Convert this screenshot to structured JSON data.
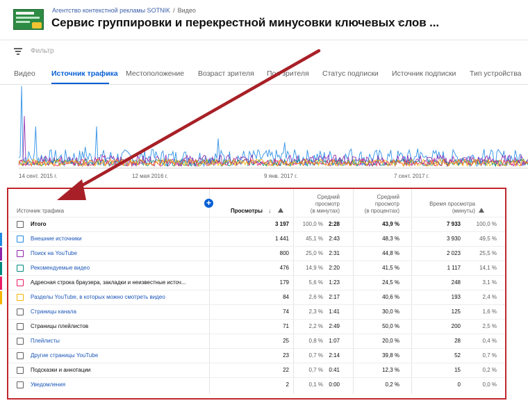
{
  "header": {
    "channel_name": "Агентство контекстной рекламы SOTNIK",
    "breadcrumb_separator": "/",
    "breadcrumb_current": "Видео",
    "title": "Сервис группировки и перекрестной минусовки ключевых слов ..."
  },
  "filter": {
    "placeholder": "Фильтр",
    "icon": "filter-icon"
  },
  "tabs": [
    {
      "label": "Видео",
      "active": false
    },
    {
      "label": "Источник трафика",
      "active": true
    },
    {
      "label": "Местоположение",
      "active": false
    },
    {
      "label": "Возраст зрителя",
      "active": false
    },
    {
      "label": "Пол зрителя",
      "active": false
    },
    {
      "label": "Статус подписки",
      "active": false
    },
    {
      "label": "Источник подписки",
      "active": false
    },
    {
      "label": "Тип устройства",
      "active": false
    }
  ],
  "chart": {
    "x_ticks": [
      "14 сент. 2015 г.",
      "12 мая 2016 г.",
      "9 янв. 2017 г.",
      "7 сент. 2017 г."
    ],
    "series_colors": [
      "#1e88e5",
      "#8e24aa",
      "#00897b",
      "#e91e63",
      "#f4b400"
    ]
  },
  "table": {
    "headers": {
      "source": "Источник трафика",
      "views": "Просмотры",
      "avg_duration": [
        "Средний",
        "просмотр",
        "(в минутах)"
      ],
      "avg_percent": [
        "Средний",
        "просмотр",
        "(в процентах)"
      ],
      "watch_time": [
        "Время просмотра",
        "(минуты)"
      ]
    },
    "rows": [
      {
        "name": "Итого",
        "views": "3 197",
        "views_pct": "100,0 %",
        "avg_dur": "2:28",
        "avg_pct": "43,9 %",
        "watch": "7 933",
        "watch_pct": "100,0 %",
        "link": false,
        "total": true,
        "color": ""
      },
      {
        "name": "Внешние источники",
        "views": "1 441",
        "views_pct": "45,1 %",
        "avg_dur": "2:43",
        "avg_pct": "48,3 %",
        "watch": "3 930",
        "watch_pct": "49,5 %",
        "link": true,
        "total": false,
        "color": "#1e88e5"
      },
      {
        "name": "Поиск на YouTube",
        "views": "800",
        "views_pct": "25,0 %",
        "avg_dur": "2:31",
        "avg_pct": "44,8 %",
        "watch": "2 023",
        "watch_pct": "25,5 %",
        "link": true,
        "total": false,
        "color": "#8e24aa"
      },
      {
        "name": "Рекомендуемые видео",
        "views": "476",
        "views_pct": "14,9 %",
        "avg_dur": "2:20",
        "avg_pct": "41,5 %",
        "watch": "1 117",
        "watch_pct": "14,1 %",
        "link": true,
        "total": false,
        "color": "#00897b"
      },
      {
        "name": "Адресная строка браузера, закладки и неизвестные источ...",
        "views": "179",
        "views_pct": "5,6 %",
        "avg_dur": "1:23",
        "avg_pct": "24,5 %",
        "watch": "248",
        "watch_pct": "3,1 %",
        "link": false,
        "total": false,
        "color": "#e91e63"
      },
      {
        "name": "Разделы YouTube, в которых можно смотреть видео",
        "views": "84",
        "views_pct": "2,6 %",
        "avg_dur": "2:17",
        "avg_pct": "40,6 %",
        "watch": "193",
        "watch_pct": "2,4 %",
        "link": true,
        "total": false,
        "color": "#f4b400"
      },
      {
        "name": "Страницы канала",
        "views": "74",
        "views_pct": "2,3 %",
        "avg_dur": "1:41",
        "avg_pct": "30,0 %",
        "watch": "125",
        "watch_pct": "1,6 %",
        "link": true,
        "total": false,
        "color": ""
      },
      {
        "name": "Страницы плейлистов",
        "views": "71",
        "views_pct": "2,2 %",
        "avg_dur": "2:49",
        "avg_pct": "50,0 %",
        "watch": "200",
        "watch_pct": "2,5 %",
        "link": false,
        "total": false,
        "color": ""
      },
      {
        "name": "Плейлисты",
        "views": "25",
        "views_pct": "0,8 %",
        "avg_dur": "1:07",
        "avg_pct": "20,0 %",
        "watch": "28",
        "watch_pct": "0,4 %",
        "link": true,
        "total": false,
        "color": ""
      },
      {
        "name": "Другие страницы YouTube",
        "views": "23",
        "views_pct": "0,7 %",
        "avg_dur": "2:14",
        "avg_pct": "39,8 %",
        "watch": "52",
        "watch_pct": "0,7 %",
        "link": true,
        "total": false,
        "color": ""
      },
      {
        "name": "Подсказки и аннотации",
        "views": "22",
        "views_pct": "0,7 %",
        "avg_dur": "0:41",
        "avg_pct": "12,3 %",
        "watch": "15",
        "watch_pct": "0,2 %",
        "link": false,
        "total": false,
        "color": ""
      },
      {
        "name": "Уведомления",
        "views": "2",
        "views_pct": "0,1 %",
        "avg_dur": "0:00",
        "avg_pct": "0,2 %",
        "watch": "0",
        "watch_pct": "0,0 %",
        "link": true,
        "total": false,
        "color": ""
      }
    ]
  },
  "annotation": {
    "highlight_color": "#c0262d",
    "arrow_color": "#a82027"
  }
}
